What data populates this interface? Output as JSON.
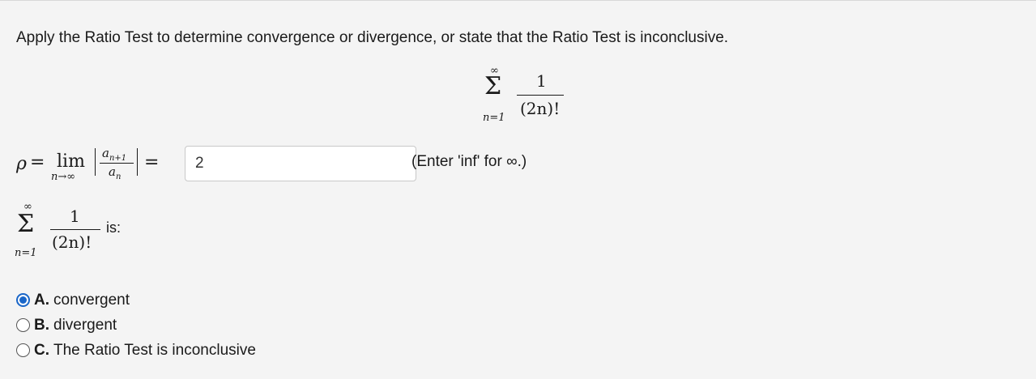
{
  "instructions": "Apply the Ratio Test to determine convergence or divergence, or state that the Ratio Test is inconclusive.",
  "series": {
    "upper": "∞",
    "lower": "n=1",
    "numerator": "1",
    "denominator": "(2n)!"
  },
  "ratio": {
    "rho": "ρ",
    "equals": "=",
    "lim": "lim",
    "lim_sub": "n→∞",
    "frac_num": "a",
    "frac_num_sub": "n+1",
    "frac_den": "a",
    "frac_den_sub": "n",
    "answer_value": "2",
    "hint": "(Enter 'inf' for ∞.)"
  },
  "is_label": "is:",
  "options": [
    {
      "letter": "A.",
      "text": "convergent",
      "checked": true
    },
    {
      "letter": "B.",
      "text": "divergent",
      "checked": false
    },
    {
      "letter": "C.",
      "text": "The Ratio Test is inconclusive",
      "checked": false
    }
  ]
}
